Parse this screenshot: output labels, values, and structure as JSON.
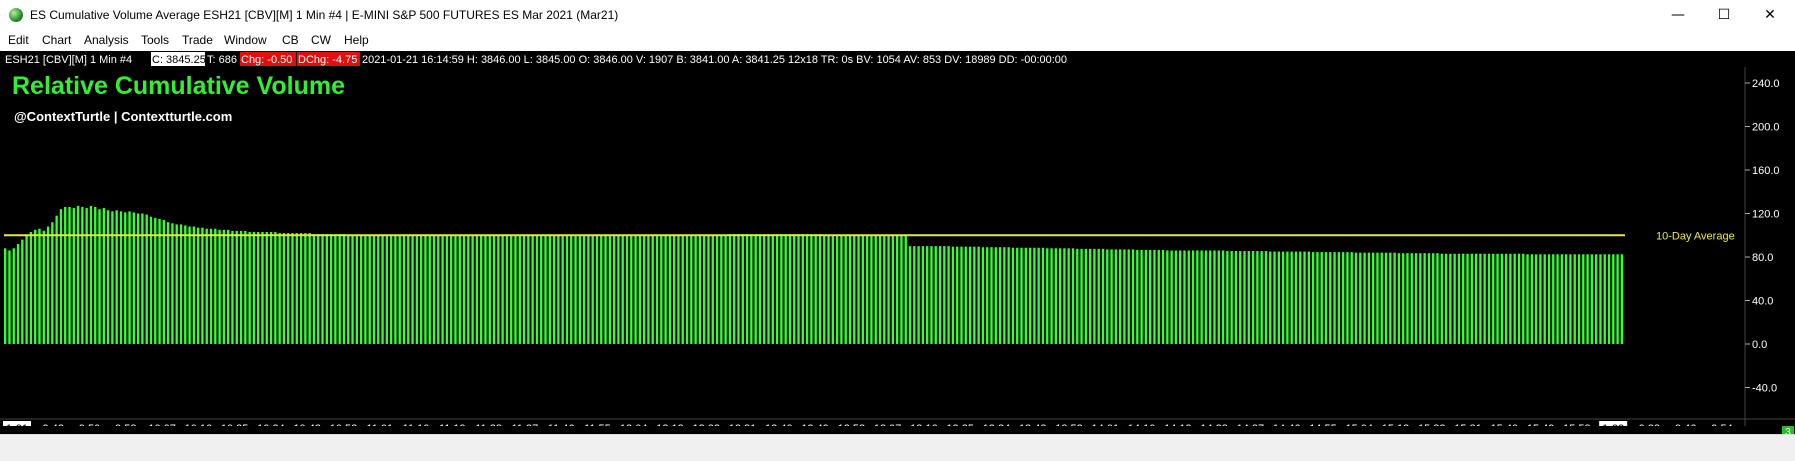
{
  "window": {
    "title": "ES Cumulative Volume Average ESH21 [CBV][M]  1 Min   #4 | E-MINI S&P 500 FUTURES ES Mar 2021 (Mar21)",
    "minimize": "—",
    "maximize": "☐",
    "close": "✕"
  },
  "menu": [
    "Edit",
    "Chart",
    "Analysis",
    "Tools",
    "Trade",
    "Window",
    "CB",
    "CW",
    "Help"
  ],
  "infobar": {
    "symbol": "ESH21 [CBV][M]  1 Min   #4",
    "close": "C: 3845.25",
    "ticks": "T: 686",
    "chg": "Chg: -0.50",
    "dchg": "DChg: -4.75",
    "details": "2021-01-21 16:14:59 H: 3846.00 L: 3845.00 O: 3846.00 V: 1907 B: 3841.00 A: 3841.25 12x18 TR: 0s BV: 1054 AV: 853 DV: 18989 DD: -00:00:00"
  },
  "overlay": {
    "title": "Relative Cumulative Volume",
    "subtitle": "@ContextTurtle | Contextturtle.com",
    "average_label": "10-Day Average"
  },
  "colors": {
    "background": "#000000",
    "bars": "#33ff33",
    "average_line": "#e8e84a",
    "title": "#33ee33",
    "infobar_red": "#e01010"
  },
  "chart_data": {
    "type": "bar",
    "xlabel": "",
    "ylabel": "",
    "ylim": [
      -60,
      260
    ],
    "y_ticks": [
      240,
      200,
      160,
      120,
      80,
      40,
      0,
      -40
    ],
    "y_tick_labels": [
      "240.0",
      "200.0",
      "160.0",
      "120.0",
      "80.0",
      "40.0",
      "0.0",
      "-40.0"
    ],
    "x_tick_labels": [
      "1-21",
      "9:42",
      "9:50",
      "9:58",
      "10:07",
      "10:16",
      "10:25",
      "10:34",
      "10:43",
      "10:52",
      "11:01",
      "11:10",
      "11:19",
      "11:28",
      "11:37",
      "11:46",
      "11:55",
      "12:04",
      "12:13",
      "12:22",
      "12:31",
      "12:40",
      "12:49",
      "12:58",
      "13:07",
      "13:16",
      "13:25",
      "13:34",
      "13:43",
      "13:52",
      "14:01",
      "14:10",
      "14:19",
      "14:28",
      "14:37",
      "14:46",
      "14:55",
      "15:04",
      "15:13",
      "15:22",
      "15:31",
      "15:40",
      "15:49",
      "15:58",
      "1-22",
      "9:38",
      "9:46",
      "9:54"
    ],
    "highlighted_x_ticks": [
      "1-21",
      "1-22"
    ],
    "reference_line": {
      "name": "10-Day Average",
      "value": 100
    },
    "series": [
      {
        "values": [
          88,
          86,
          88,
          92,
          96,
          100,
          103,
          105,
          106,
          104,
          108,
          112,
          118,
          124,
          126,
          126,
          125,
          127,
          126,
          125,
          127,
          126,
          124,
          125,
          123,
          122,
          123,
          122,
          121,
          122,
          121,
          120,
          120,
          119,
          117,
          116,
          115,
          114,
          112,
          111,
          110,
          110,
          109,
          108,
          108,
          107,
          107,
          106,
          106,
          106,
          105,
          105,
          105,
          104,
          104,
          104,
          104,
          103,
          103,
          103,
          103,
          103,
          103,
          103,
          102,
          102,
          102,
          102,
          102,
          102,
          102,
          102,
          101,
          101,
          101,
          101,
          101,
          101,
          101,
          101,
          100,
          100,
          100,
          100,
          100,
          100,
          100,
          100,
          100,
          100,
          100,
          100,
          100,
          100,
          100,
          100,
          100,
          100,
          100,
          100,
          100,
          100,
          100,
          100,
          100,
          100,
          100,
          100,
          100,
          100,
          100,
          100,
          100,
          100,
          100,
          100,
          100,
          100,
          100,
          100,
          100,
          100,
          100,
          100,
          100,
          100,
          100,
          100,
          100,
          100,
          100,
          100,
          100,
          100,
          100,
          100,
          100,
          100,
          100,
          100,
          100,
          100,
          100,
          100,
          100,
          100,
          100,
          100,
          100,
          100,
          100,
          100,
          100,
          100,
          100,
          100,
          100,
          100,
          100,
          100,
          100,
          100,
          100,
          100,
          100,
          100,
          100,
          100,
          100,
          101,
          101,
          101,
          101,
          101,
          101,
          101,
          101,
          101,
          101,
          101,
          101,
          101,
          101,
          101,
          101,
          101,
          101,
          101,
          101,
          101,
          101,
          100,
          100,
          100,
          100,
          100,
          100,
          100,
          100,
          100,
          100,
          100,
          100,
          100,
          100,
          100,
          100,
          100,
          100,
          100,
          100,
          90,
          90,
          90,
          90,
          90,
          90,
          90,
          90,
          90,
          90,
          89.5,
          89.5,
          89.5,
          89.5,
          89.5,
          89.5,
          89.5,
          89,
          89,
          89,
          89,
          89,
          89,
          89,
          88.5,
          88.5,
          88.5,
          88.5,
          88.5,
          88.5,
          88.5,
          88.5,
          88,
          88,
          88,
          88,
          88,
          88,
          88,
          87.5,
          87.5,
          87.5,
          87.5,
          87.5,
          87.5,
          87.5,
          87,
          87,
          87,
          87,
          87,
          87,
          87,
          86.5,
          86.5,
          86.5,
          86.5,
          86.5,
          86.5,
          86.5,
          86,
          86,
          86,
          86,
          86,
          86,
          86,
          86,
          86,
          86,
          86,
          86,
          86,
          86,
          85.5,
          85.5,
          85.5,
          85.5,
          85.5,
          85.5,
          85.5,
          85.5,
          85.5,
          85.5,
          85,
          85,
          85,
          85,
          85,
          85,
          85,
          85,
          85,
          85,
          84.5,
          84.5,
          84.5,
          84.5,
          84.5,
          84.5,
          84.5,
          84.5,
          84.5,
          84.5,
          84,
          84,
          84,
          84,
          84,
          84,
          84,
          84,
          84,
          84,
          83.5,
          83.5,
          83.5,
          83.5,
          83.5,
          83.5,
          83.5,
          83.5,
          83.5,
          83.5,
          83,
          83,
          83,
          83,
          83,
          83,
          83,
          83,
          83,
          83,
          83,
          83,
          83,
          83,
          83,
          83,
          83,
          83,
          83,
          83,
          82.5,
          82.5,
          82.5,
          82.5,
          82.5,
          82.5,
          82.5,
          82.5,
          82.5,
          82.5,
          82.5,
          82.5,
          82.5,
          82.5,
          82.5,
          82.5,
          82.5,
          82.5,
          82.5,
          82.5,
          82.5,
          82.5,
          82.5
        ]
      }
    ]
  }
}
